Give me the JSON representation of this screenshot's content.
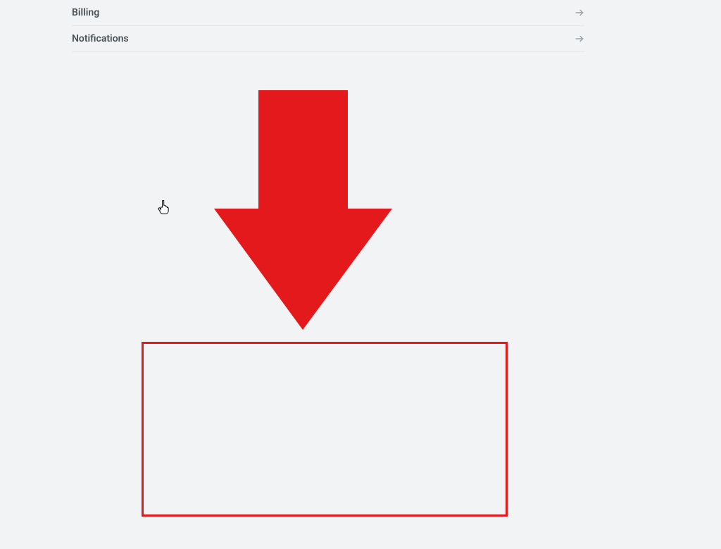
{
  "settings": {
    "items": [
      {
        "label": "Billing"
      },
      {
        "label": "Notifications"
      }
    ]
  },
  "annotation": {
    "arrow_color": "#e4191c",
    "box_color": "#e4191c"
  }
}
